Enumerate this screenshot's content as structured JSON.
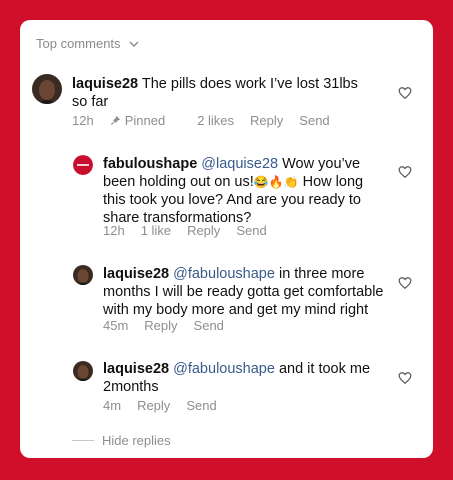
{
  "header": {
    "label": "Top comments"
  },
  "comments": [
    {
      "username": "laquise28",
      "text": "The pills does work I’ve lost 31lbs so far",
      "time": "12h",
      "pinned": "Pinned",
      "likes": "2 likes",
      "reply": "Reply",
      "send": "Send"
    },
    {
      "username": "fabuloushape",
      "mention": "@laquise28",
      "text_line1": " Wow you’ve",
      "text_line2_a": "been holding out on us!",
      "emoji": "😂🔥👏",
      "text_line2_b": " How long",
      "text_line3": "this took you love? And are you ready to",
      "text_line4": "share transformations?",
      "time": "12h",
      "likes": "1 like",
      "reply": "Reply",
      "send": "Send"
    },
    {
      "username": "laquise28",
      "mention": "@fabuloushape",
      "text_line1": " in three more",
      "text_line2": "months I will be ready gotta get comfortable",
      "text_line3": "with my body more and get my mind right",
      "time": "45m",
      "reply": "Reply",
      "send": "Send"
    },
    {
      "username": "laquise28",
      "mention": "@fabuloushape",
      "text_line1": " and it took me",
      "text_line2": "2months",
      "time": "4m",
      "reply": "Reply",
      "send": "Send"
    }
  ],
  "hide_replies": "Hide replies",
  "colors": {
    "background": "#d0102b",
    "mention": "#3a5a8c",
    "meta": "#8e8e8e"
  }
}
